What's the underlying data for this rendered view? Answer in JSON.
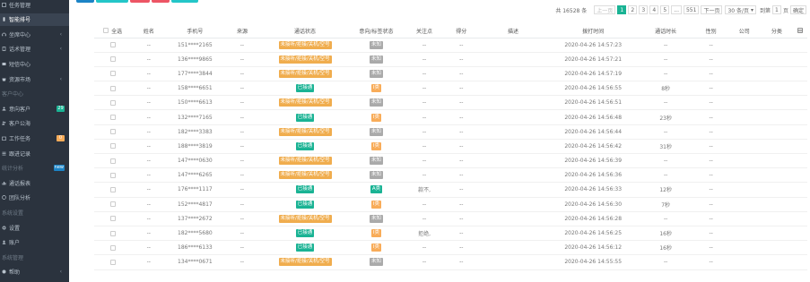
{
  "sidebar": {
    "items": [
      {
        "label": "任务管理",
        "type": "item",
        "icon": "task-icon",
        "arrow": false
      },
      {
        "label": "智能排号",
        "type": "item",
        "icon": "phone-icon",
        "arrow": false,
        "active": true
      },
      {
        "label": "坐席中心",
        "type": "item",
        "icon": "headset-icon",
        "arrow": true
      },
      {
        "label": "话术管理",
        "type": "item",
        "icon": "script-icon",
        "arrow": true
      },
      {
        "label": "短信中心",
        "type": "item",
        "icon": "sms-icon",
        "arrow": false
      },
      {
        "label": "资源市场",
        "type": "item",
        "icon": "market-icon",
        "arrow": true
      },
      {
        "label": "客户中心",
        "type": "header"
      },
      {
        "label": "意向客户",
        "type": "item",
        "icon": "user-icon",
        "badge": "29",
        "badge_color": "#1ab394"
      },
      {
        "label": "客户公海",
        "type": "item",
        "icon": "users-icon"
      },
      {
        "label": "工作任务",
        "type": "item",
        "icon": "calendar-icon",
        "badge": "0",
        "badge_color": "#f8ac59"
      },
      {
        "label": "跟进记录",
        "type": "item",
        "icon": "list-icon"
      },
      {
        "label": "统计分析",
        "type": "header",
        "badge": "new",
        "badge_color": "#1c84c6"
      },
      {
        "label": "通话报表",
        "type": "item",
        "icon": "chart-icon"
      },
      {
        "label": "团队分析",
        "type": "item",
        "icon": "team-icon"
      },
      {
        "label": "系统设置",
        "type": "header"
      },
      {
        "label": "设置",
        "type": "item",
        "icon": "gear-icon"
      },
      {
        "label": "账户",
        "type": "item",
        "icon": "account-icon"
      },
      {
        "label": "系统管理",
        "type": "header"
      },
      {
        "label": "帮助",
        "type": "item",
        "icon": "help-icon",
        "arrow": true
      }
    ]
  },
  "pager": {
    "total": "共 16528 条",
    "prev": "上一页",
    "pages": [
      "1",
      "2",
      "3",
      "4",
      "5",
      "...",
      "551"
    ],
    "next": "下一页",
    "page_size": "30 条/页",
    "goto": "到第",
    "goto_value": "1",
    "goto_unit": "页",
    "confirm": "确定"
  },
  "table": {
    "headers": [
      "全选",
      "姓名",
      "手机号",
      "来源",
      "通话状态",
      "意向/标签状态",
      "关注点",
      "得分",
      "描述",
      "拨打时间",
      "通话时长",
      "性别",
      "公司",
      "分类"
    ],
    "rows": [
      {
        "name": "--",
        "phone": "151****2165",
        "source": "--",
        "status": "未接听/拒接/关机/空号",
        "status_type": "warn",
        "intent": "未知",
        "intent_type": "unknown",
        "focus": "--",
        "score": "--",
        "time": "2020-04-26 14:57:23",
        "dur": "--",
        "gender": "--"
      },
      {
        "name": "--",
        "phone": "136****9865",
        "source": "--",
        "status": "未接听/拒接/关机/空号",
        "status_type": "warn",
        "intent": "未知",
        "intent_type": "unknown",
        "focus": "--",
        "score": "--",
        "time": "2020-04-26 14:57:21",
        "dur": "--",
        "gender": "--"
      },
      {
        "name": "--",
        "phone": "177****3844",
        "source": "--",
        "status": "未接听/拒接/关机/空号",
        "status_type": "warn",
        "intent": "未知",
        "intent_type": "unknown",
        "focus": "--",
        "score": "--",
        "time": "2020-04-26 14:57:19",
        "dur": "--",
        "gender": "--"
      },
      {
        "name": "--",
        "phone": "158****6651",
        "source": "--",
        "status": "已接通",
        "status_type": "ok",
        "intent": "I类",
        "intent_type": "I",
        "focus": "--",
        "score": "--",
        "time": "2020-04-26 14:56:55",
        "dur": "8秒",
        "gender": "--"
      },
      {
        "name": "--",
        "phone": "150****6613",
        "source": "--",
        "status": "未接听/拒接/关机/空号",
        "status_type": "warn",
        "intent": "未知",
        "intent_type": "unknown",
        "focus": "--",
        "score": "--",
        "time": "2020-04-26 14:56:51",
        "dur": "--",
        "gender": "--"
      },
      {
        "name": "--",
        "phone": "132****7165",
        "source": "--",
        "status": "已接通",
        "status_type": "ok",
        "intent": "I类",
        "intent_type": "I",
        "focus": "--",
        "score": "--",
        "time": "2020-04-26 14:56:48",
        "dur": "23秒",
        "gender": "--"
      },
      {
        "name": "--",
        "phone": "182****3383",
        "source": "--",
        "status": "未接听/拒接/关机/空号",
        "status_type": "warn",
        "intent": "未知",
        "intent_type": "unknown",
        "focus": "--",
        "score": "--",
        "time": "2020-04-26 14:56:44",
        "dur": "--",
        "gender": "--"
      },
      {
        "name": "--",
        "phone": "188****3819",
        "source": "--",
        "status": "已接通",
        "status_type": "ok",
        "intent": "I类",
        "intent_type": "I",
        "focus": "--",
        "score": "--",
        "time": "2020-04-26 14:56:42",
        "dur": "31秒",
        "gender": "--"
      },
      {
        "name": "--",
        "phone": "147****0630",
        "source": "--",
        "status": "未接听/拒接/关机/空号",
        "status_type": "warn",
        "intent": "未知",
        "intent_type": "unknown",
        "focus": "--",
        "score": "--",
        "time": "2020-04-26 14:56:39",
        "dur": "--",
        "gender": "--"
      },
      {
        "name": "--",
        "phone": "147****6265",
        "source": "--",
        "status": "未接听/拒接/关机/空号",
        "status_type": "warn",
        "intent": "未知",
        "intent_type": "unknown",
        "focus": "--",
        "score": "--",
        "time": "2020-04-26 14:56:36",
        "dur": "--",
        "gender": "--"
      },
      {
        "name": "--",
        "phone": "176****1117",
        "source": "--",
        "status": "已接通",
        "status_type": "ok",
        "intent": "A类",
        "intent_type": "A",
        "focus": "款不,",
        "score": "--",
        "time": "2020-04-26 14:56:33",
        "dur": "12秒",
        "gender": "--"
      },
      {
        "name": "--",
        "phone": "152****4817",
        "source": "--",
        "status": "已接通",
        "status_type": "ok",
        "intent": "I类",
        "intent_type": "I",
        "focus": "--",
        "score": "--",
        "time": "2020-04-26 14:56:30",
        "dur": "7秒",
        "gender": "--"
      },
      {
        "name": "--",
        "phone": "137****2672",
        "source": "--",
        "status": "未接听/拒接/关机/空号",
        "status_type": "warn",
        "intent": "未知",
        "intent_type": "unknown",
        "focus": "--",
        "score": "--",
        "time": "2020-04-26 14:56:28",
        "dur": "--",
        "gender": "--"
      },
      {
        "name": "--",
        "phone": "182****5680",
        "source": "--",
        "status": "已接通",
        "status_type": "ok",
        "intent": "I类",
        "intent_type": "I",
        "focus": "拒绝,",
        "score": "--",
        "time": "2020-04-26 14:56:25",
        "dur": "16秒",
        "gender": "--"
      },
      {
        "name": "--",
        "phone": "186****6133",
        "source": "--",
        "status": "已接通",
        "status_type": "ok",
        "intent": "I类",
        "intent_type": "I",
        "focus": "--",
        "score": "--",
        "time": "2020-04-26 14:56:12",
        "dur": "16秒",
        "gender": "--"
      },
      {
        "name": "--",
        "phone": "134****0671",
        "source": "--",
        "status": "未接听/拒接/关机/空号",
        "status_type": "warn",
        "intent": "未知",
        "intent_type": "unknown",
        "focus": "--",
        "score": "--",
        "time": "2020-04-26 14:55:55",
        "dur": "--",
        "gender": "--"
      }
    ]
  },
  "colors": {
    "sidebar_bg": "#2b333e",
    "accent": "#1ab394",
    "warn": "#f0ad4e",
    "unknown": "#aaaaaa",
    "btn_blue": "#1c84c6",
    "btn_red": "#ed5565"
  },
  "icons": {
    "columns": "columns-icon"
  }
}
